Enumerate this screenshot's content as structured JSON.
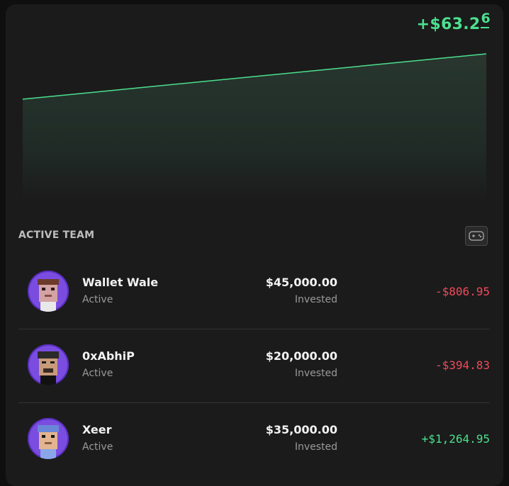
{
  "header": {
    "pnl_main": "+$63.2",
    "pnl_frac": "6"
  },
  "chart_data": {
    "type": "area",
    "x": [
      0,
      1
    ],
    "y": [
      0,
      1
    ],
    "title": "",
    "xlabel": "",
    "ylabel": "",
    "line_color": "#4be08e"
  },
  "team": {
    "title": "ACTIVE TEAM",
    "members": [
      {
        "name": "Wallet Wale",
        "status": "Active",
        "amount": "$45,000.00",
        "amount_label": "Invested",
        "pnl": "-$806.95",
        "pnl_sign": "neg",
        "avatar_icon": "pixel-avatar-icon"
      },
      {
        "name": "0xAbhiP",
        "status": "Active",
        "amount": "$20,000.00",
        "amount_label": "Invested",
        "pnl": "-$394.83",
        "pnl_sign": "neg",
        "avatar_icon": "pixel-avatar-icon"
      },
      {
        "name": "Xeer",
        "status": "Active",
        "amount": "$35,000.00",
        "amount_label": "Invested",
        "pnl": "+$1,264.95",
        "pnl_sign": "pos",
        "avatar_icon": "pixel-avatar-icon"
      }
    ]
  },
  "colors": {
    "positive": "#4be08e",
    "negative": "#f04a5a",
    "avatar_bg": "#7a4de0"
  }
}
